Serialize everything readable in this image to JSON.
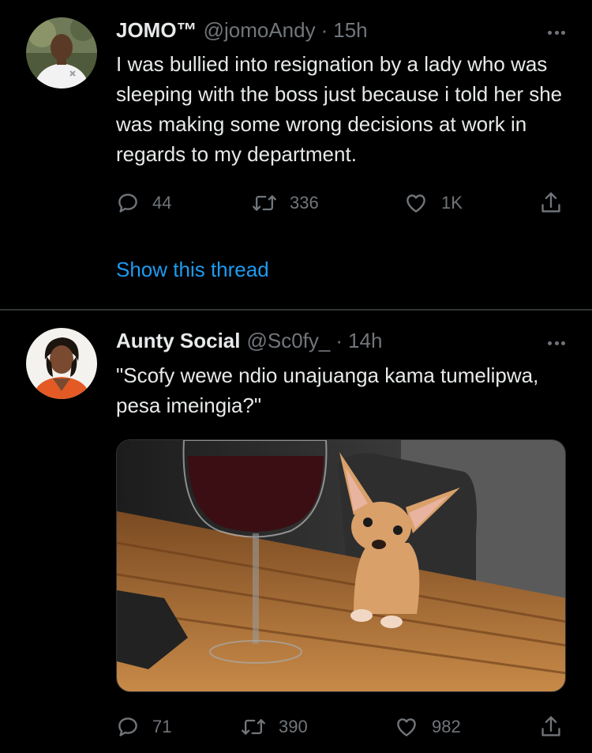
{
  "tweets": [
    {
      "display_name": "JOMO™",
      "handle": "@jomoAndy",
      "separator": "·",
      "time": "15h",
      "text": "I was bullied into resignation by a lady who was sleeping with the boss just because i told her she was making some wrong decisions at work in regards to my department.",
      "replies": "44",
      "retweets": "336",
      "likes": "1K",
      "show_thread": "Show this thread"
    },
    {
      "display_name": "Aunty Social",
      "handle": "@Sc0fy_",
      "separator": "·",
      "time": "14h",
      "text": "\"Scofy wewe ndio unajuanga kama tumelipwa, pesa imeingia?\"",
      "replies": "71",
      "retweets": "390",
      "likes": "982"
    }
  ],
  "icons": {
    "reply": "speech-bubble-icon",
    "retweet": "retweet-arrows-icon",
    "like": "heart-icon",
    "share": "share-upload-icon",
    "more": "three-dots-icon"
  },
  "colors": {
    "background": "#000000",
    "text": "#e7e9ea",
    "muted": "#71767b",
    "link": "#1d9bf0",
    "divider": "#2f3336"
  }
}
